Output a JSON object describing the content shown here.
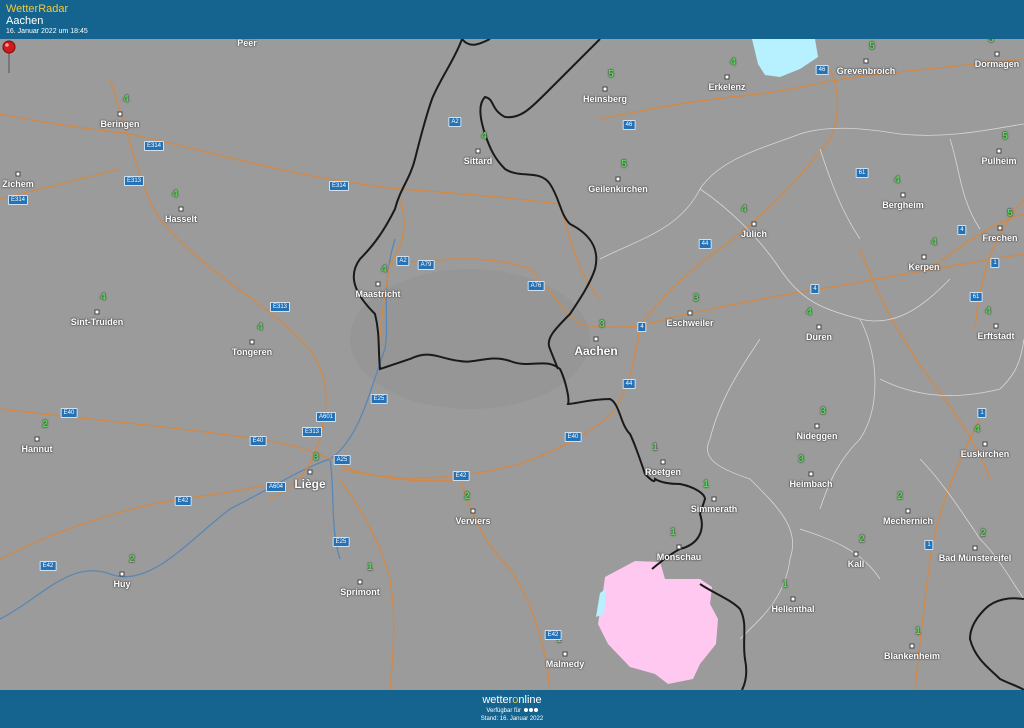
{
  "header": {
    "brand": "WetterRadar",
    "location": "Aachen",
    "timestamp": "16. Januar 2022 um 18:45"
  },
  "footer": {
    "logo_pre": "wetter",
    "logo_o": "o",
    "logo_post": "nline",
    "availability": "Verfügbar für",
    "status": "Stand: 16. Januar 2022"
  },
  "colors": {
    "header_bg": "#14648f",
    "brand": "#f3c93a",
    "map_bg": "#9b9b9b",
    "border": "#1a1a1a",
    "road": "#d08a4a",
    "river": "#5b86b5",
    "rain_light": "#b7f1ff",
    "snow": "#ffc8f0",
    "temperature": "#5fd35f",
    "road_sign": "#2471b5"
  },
  "cities": [
    {
      "name": "Peer",
      "temp": ""
    },
    {
      "name": "Beringen",
      "temp": "4"
    },
    {
      "name": "Zichem",
      "temp": ""
    },
    {
      "name": "Hasselt",
      "temp": "4"
    },
    {
      "name": "Sint-Truiden",
      "temp": "4"
    },
    {
      "name": "Tongeren",
      "temp": "4"
    },
    {
      "name": "Hannut",
      "temp": "2"
    },
    {
      "name": "Maastricht",
      "temp": "4"
    },
    {
      "name": "Liège",
      "temp": "3"
    },
    {
      "name": "Huy",
      "temp": "2"
    },
    {
      "name": "Sprimont",
      "temp": "1"
    },
    {
      "name": "Verviers",
      "temp": "2"
    },
    {
      "name": "Malmedy",
      "temp": "1"
    },
    {
      "name": "Sittard",
      "temp": "4"
    },
    {
      "name": "Heinsberg",
      "temp": "5"
    },
    {
      "name": "Geilenkirchen",
      "temp": "5"
    },
    {
      "name": "Erkelenz",
      "temp": "4"
    },
    {
      "name": "Grevenbroich",
      "temp": "5"
    },
    {
      "name": "Dormagen",
      "temp": "5"
    },
    {
      "name": "Pulheim",
      "temp": "5"
    },
    {
      "name": "Bergheim",
      "temp": "4"
    },
    {
      "name": "Jülich",
      "temp": "4"
    },
    {
      "name": "Frechen",
      "temp": "5"
    },
    {
      "name": "Kerpen",
      "temp": "4"
    },
    {
      "name": "Erftstadt",
      "temp": "4"
    },
    {
      "name": "Eschweiler",
      "temp": "3"
    },
    {
      "name": "Aachen",
      "temp": "3"
    },
    {
      "name": "Düren",
      "temp": "4"
    },
    {
      "name": "Nideggen",
      "temp": "3"
    },
    {
      "name": "Euskirchen",
      "temp": "4"
    },
    {
      "name": "Roetgen",
      "temp": "1"
    },
    {
      "name": "Heimbach",
      "temp": "3"
    },
    {
      "name": "Simmerath",
      "temp": "1"
    },
    {
      "name": "Mechernich",
      "temp": "2"
    },
    {
      "name": "Monschau",
      "temp": "1"
    },
    {
      "name": "Kall",
      "temp": "2"
    },
    {
      "name": "Bad Münstereifel",
      "temp": "2"
    },
    {
      "name": "Hellenthal",
      "temp": "1"
    },
    {
      "name": "Blankenheim",
      "temp": "1"
    }
  ],
  "roads": [
    "A2",
    "E314",
    "E313",
    "E314",
    "E314",
    "A2",
    "A79",
    "A76",
    "E313",
    "A601",
    "E25",
    "E40",
    "E313",
    "A25",
    "A604",
    "E42",
    "E40",
    "E42",
    "E40",
    "E25",
    "E42",
    "E42",
    "46",
    "46",
    "61",
    "44",
    "4",
    "4",
    "4",
    "61",
    "44",
    "1",
    "1",
    "1"
  ]
}
